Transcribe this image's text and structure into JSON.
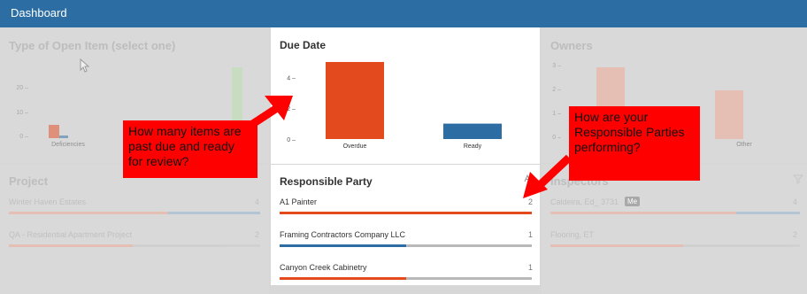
{
  "header": {
    "title": "Dashboard"
  },
  "type_panel": {
    "title": "Type of Open Item (select one)",
    "ticks": [
      "20 –",
      "10 –",
      "0 –"
    ],
    "category": "Deficiencies"
  },
  "project_panel": {
    "title": "Project",
    "items": [
      {
        "label": "Winter Haven Estates",
        "count": "4"
      },
      {
        "label": "QA - Residential Apartment Project",
        "count": "2"
      }
    ]
  },
  "owners_panel": {
    "title": "Owners",
    "ticks": [
      "3 –",
      "2 –",
      "1 –",
      "0 –"
    ],
    "category": "Other"
  },
  "inspectors_panel": {
    "title": "Inspectors",
    "items": [
      {
        "label": "Caldeira, Ed_ 3731",
        "badge": "Me",
        "count": "4"
      },
      {
        "label": "Flooring, ET",
        "count": "2"
      }
    ]
  },
  "due_date": {
    "title": "Due Date",
    "chart_data": {
      "type": "bar",
      "title": "Due Date",
      "categories": [
        "Overdue",
        "Ready"
      ],
      "values": [
        5,
        1
      ],
      "ylim": [
        0,
        5
      ],
      "ticks": [
        "4 –",
        "2 –",
        "0 –"
      ],
      "colors": [
        "#e34a1e",
        "#2c6ea3"
      ],
      "xlabel": "",
      "ylabel": ""
    }
  },
  "responsible_party": {
    "title": "Responsible Party",
    "items": [
      {
        "label": "A1 Painter",
        "count": "2",
        "progress": 1.0,
        "color": "#e34a1e"
      },
      {
        "label": "Framing Contractors Company LLC",
        "count": "1",
        "progress": 0.5,
        "color": "#2c6ea3"
      },
      {
        "label": "Canyon Creek Cabinetry",
        "count": "1",
        "progress": 0.5,
        "color": "#e34a1e"
      }
    ]
  },
  "callouts": {
    "left": "How many items are past due and ready for review?",
    "right": "How are your Responsible Parties performing?"
  },
  "colors": {
    "accent": "#2c6ea3",
    "overdue": "#e34a1e",
    "callout": "#ff0000"
  }
}
